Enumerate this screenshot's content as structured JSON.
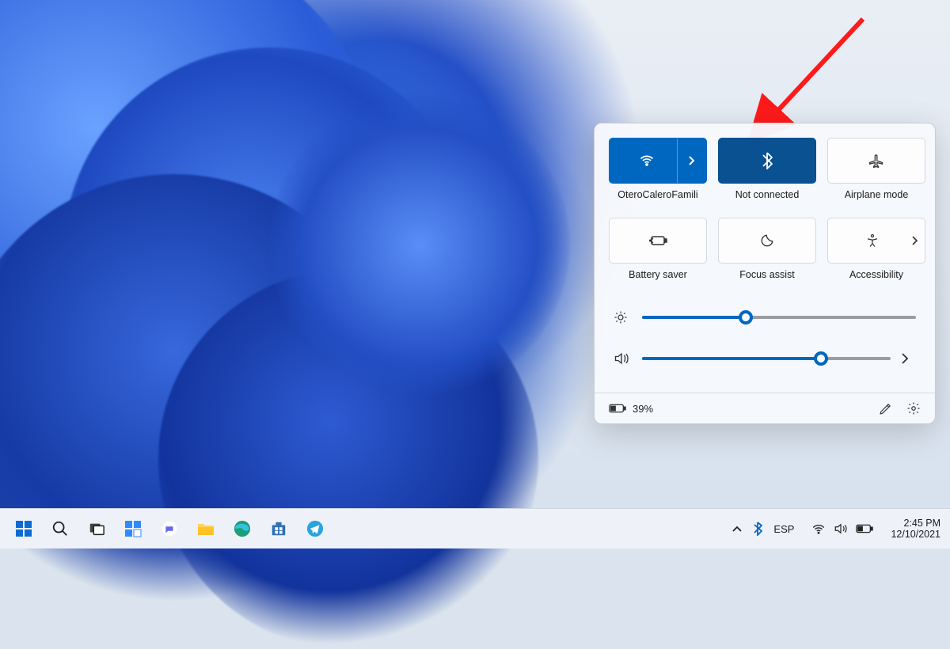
{
  "annotation": {
    "points_to": "bluetooth-tile"
  },
  "quick_settings": {
    "tiles": [
      {
        "id": "wifi",
        "label": "OteroCaleroFamili",
        "active": true,
        "has_arrow": true,
        "icon": "wifi-icon"
      },
      {
        "id": "bluetooth",
        "label": "Not connected",
        "active": true,
        "has_arrow": false,
        "icon": "bluetooth-icon"
      },
      {
        "id": "airplane",
        "label": "Airplane mode",
        "active": false,
        "has_arrow": false,
        "icon": "airplane-icon"
      },
      {
        "id": "battery-saver",
        "label": "Battery saver",
        "active": false,
        "has_arrow": false,
        "icon": "battery-saver-icon"
      },
      {
        "id": "focus-assist",
        "label": "Focus assist",
        "active": false,
        "has_arrow": false,
        "icon": "focus-assist-icon"
      },
      {
        "id": "accessibility",
        "label": "Accessibility",
        "active": false,
        "has_arrow": true,
        "icon": "accessibility-icon"
      }
    ],
    "brightness_percent": 38,
    "volume_percent": 72,
    "battery_label": "39%"
  },
  "taskbar": {
    "apps": [
      "start",
      "search",
      "task-view",
      "widgets",
      "chat",
      "explorer",
      "edge",
      "store",
      "telegram"
    ],
    "tray": {
      "overflow_chevron": "^",
      "bluetooth": true,
      "input_lang": "ESP",
      "time": "2:45 PM",
      "date": "12/10/2021"
    }
  },
  "colors": {
    "accent": "#0067c0",
    "accent_dark": "#095191"
  }
}
